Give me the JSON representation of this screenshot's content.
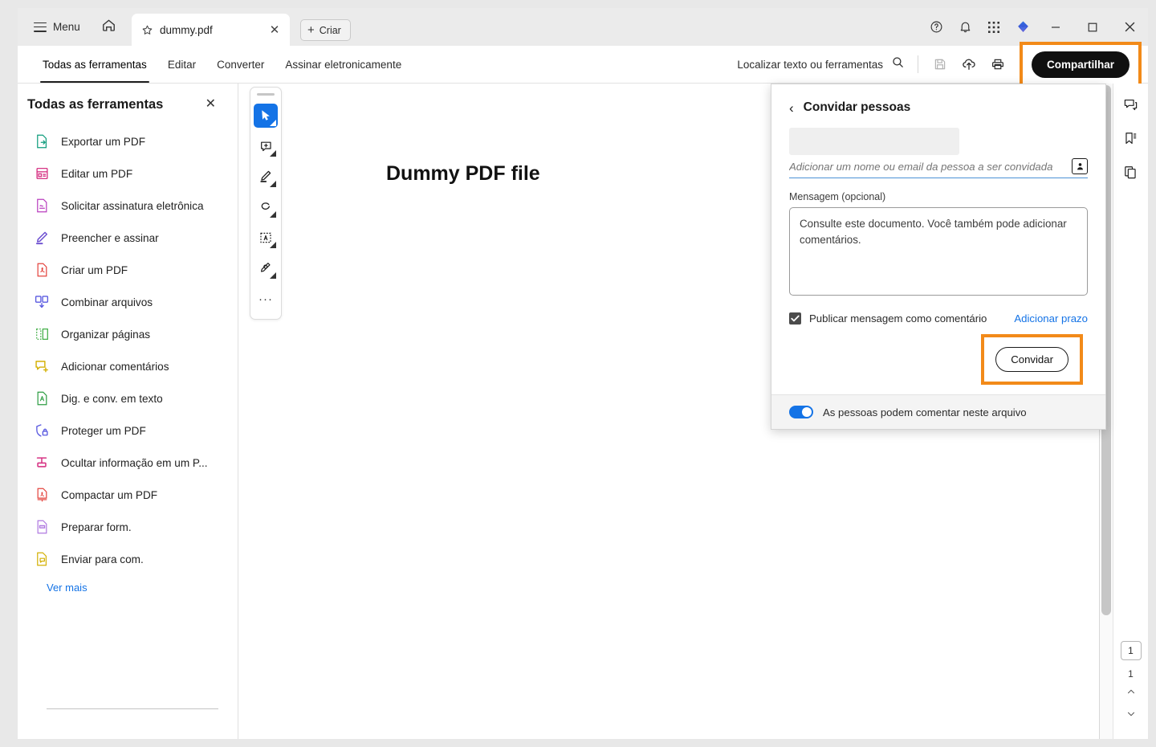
{
  "titlebar": {
    "menu_label": "Menu",
    "home_icon": "home-icon",
    "tab": {
      "title": "dummy.pdf",
      "star_icon": "star-icon",
      "close_icon": "close-icon"
    },
    "new_tab_label": "Criar",
    "icons": [
      "help-icon",
      "bell-icon",
      "apps-grid-icon",
      "adobe-logo-icon"
    ],
    "window_controls": [
      "minimize-icon",
      "maximize-icon",
      "close-icon"
    ]
  },
  "toolbar": {
    "tabs": [
      {
        "label": "Todas as ferramentas",
        "active": true
      },
      {
        "label": "Editar",
        "active": false
      },
      {
        "label": "Converter",
        "active": false
      },
      {
        "label": "Assinar eletronicamente",
        "active": false
      }
    ],
    "find_placeholder": "Localizar texto ou ferramentas",
    "icons": [
      "save-icon",
      "cloud-upload-icon",
      "print-icon"
    ],
    "share_label": "Compartilhar",
    "share_highlight_color": "#f28a19"
  },
  "left_panel": {
    "title": "Todas as ferramentas",
    "close_icon": "close-icon",
    "items": [
      {
        "label": "Exportar um PDF",
        "icon": "export-pdf-icon",
        "color": "#0f9c7c"
      },
      {
        "label": "Editar um PDF",
        "icon": "edit-pdf-icon",
        "color": "#d63384"
      },
      {
        "label": "Solicitar assinatura eletrônica",
        "icon": "request-signature-icon",
        "color": "#b93fbf"
      },
      {
        "label": "Preencher e assinar",
        "icon": "fill-sign-icon",
        "color": "#6c4fd0"
      },
      {
        "label": "Criar um PDF",
        "icon": "create-pdf-icon",
        "color": "#e4453f"
      },
      {
        "label": "Combinar arquivos",
        "icon": "combine-files-icon",
        "color": "#5a5ae0"
      },
      {
        "label": "Organizar páginas",
        "icon": "organize-pages-icon",
        "color": "#46b04a"
      },
      {
        "label": "Adicionar comentários",
        "icon": "add-comments-icon",
        "color": "#d4b106"
      },
      {
        "label": "Dig. e conv. em texto",
        "icon": "scan-ocr-icon",
        "color": "#2f9e44"
      },
      {
        "label": "Proteger um PDF",
        "icon": "protect-pdf-icon",
        "color": "#5a5ae0"
      },
      {
        "label": "Ocultar informação em um P...",
        "icon": "redact-icon",
        "color": "#d63384"
      },
      {
        "label": "Compactar um PDF",
        "icon": "compress-pdf-icon",
        "color": "#e4453f"
      },
      {
        "label": "Preparar form.",
        "icon": "prepare-form-icon",
        "color": "#b07ae0"
      },
      {
        "label": "Enviar para com.",
        "icon": "send-for-comments-icon",
        "color": "#d4b106"
      }
    ],
    "see_more_label": "Ver mais"
  },
  "quick_tools": [
    {
      "icon": "select-cursor-icon",
      "active": true
    },
    {
      "icon": "add-comment-icon",
      "active": false
    },
    {
      "icon": "highlight-pen-icon",
      "active": false
    },
    {
      "icon": "freehand-draw-icon",
      "active": false
    },
    {
      "icon": "select-text-icon",
      "active": false
    },
    {
      "icon": "sign-icon",
      "active": false
    },
    {
      "icon": "more-tools-icon",
      "active": false
    }
  ],
  "document": {
    "heading": "Dummy PDF file"
  },
  "right_rail": {
    "icons": [
      "comments-panel-icon",
      "bookmarks-panel-icon",
      "pages-panel-icon"
    ],
    "current_page": "1",
    "total_pages": "1",
    "prev_icon": "chevron-up-icon",
    "next_icon": "chevron-down-icon"
  },
  "share_popover": {
    "back_icon": "chevron-left-icon",
    "title": "Convidar pessoas",
    "invite_placeholder": "Adicionar um nome ou email da pessoa a ser convidada",
    "invite_value": "",
    "contact_icon": "contact-book-icon",
    "message_label": "Mensagem (opcional)",
    "message_value": "Consulte este documento. Você também pode adicionar comentários.",
    "checkbox_label": "Publicar mensagem como comentário",
    "checkbox_checked": true,
    "deadline_link": "Adicionar prazo",
    "invite_button": "Convidar",
    "invite_highlight_color": "#f28a19",
    "footer_toggle_label": "As pessoas podem comentar neste arquivo",
    "footer_toggle_on": true,
    "toggle_color": "#1473e6"
  }
}
